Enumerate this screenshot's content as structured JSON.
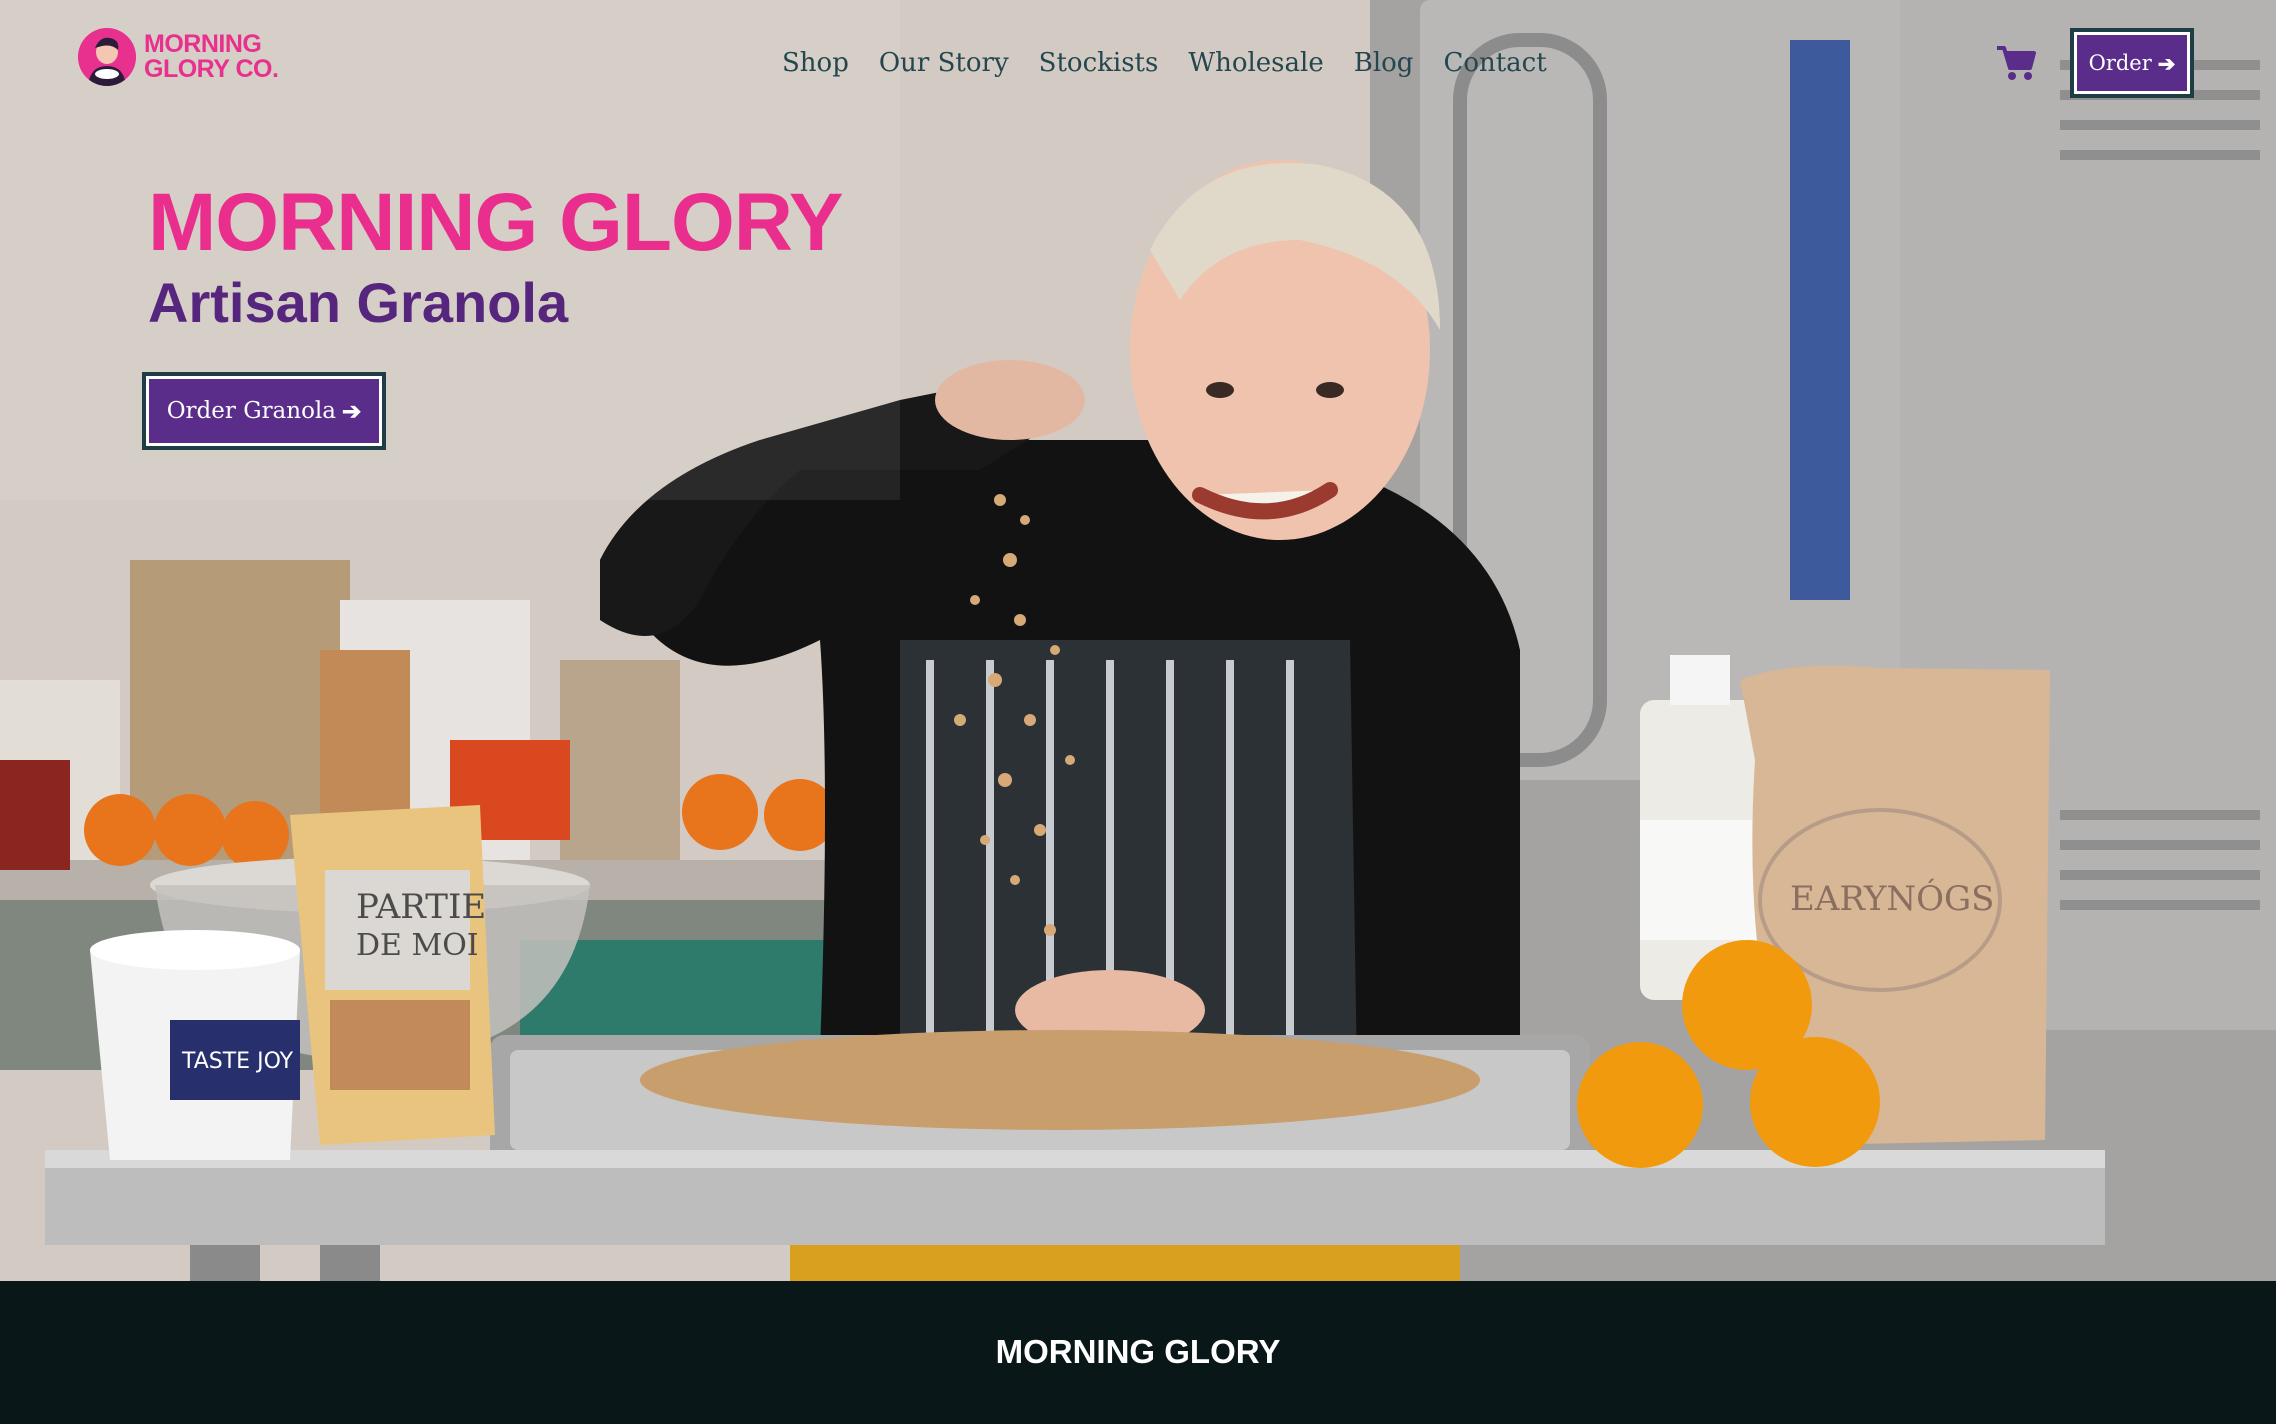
{
  "brand": {
    "logo_line1": "MORNING",
    "logo_line2": "GLORY CO.",
    "accent_color": "#ea2e8e",
    "purple_color": "#5b2d8a",
    "dark_color": "#0a1718"
  },
  "nav": {
    "items": [
      {
        "label": "Shop"
      },
      {
        "label": "Our Story"
      },
      {
        "label": "Stockists"
      },
      {
        "label": "Wholesale"
      },
      {
        "label": "Blog"
      },
      {
        "label": "Contact"
      }
    ],
    "cart_icon": "shopping-cart-icon",
    "order_label": "Order",
    "order_icon": "arrow-right-icon"
  },
  "hero": {
    "title": "MORNING GLORY",
    "subtitle": "Artisan Granola",
    "cta_label": "Order Granola",
    "cta_icon": "arrow-right-icon",
    "photo_labels": {
      "bag_left_line1": "PARTIE",
      "bag_left_line2": "DE MOI",
      "bag_right": "EARYNÓGS",
      "tub": "TASTE JOY"
    }
  },
  "band": {
    "title": "MORNING GLORY"
  }
}
